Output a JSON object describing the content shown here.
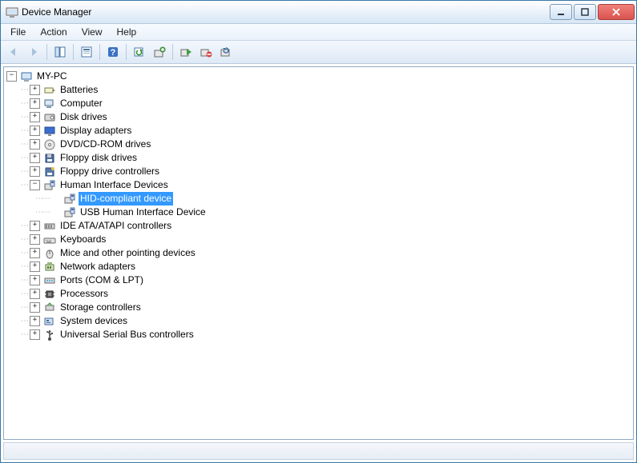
{
  "window": {
    "title": "Device Manager"
  },
  "menu": {
    "file": "File",
    "action": "Action",
    "view": "View",
    "help": "Help"
  },
  "toolbar": {
    "back": "Back",
    "forward": "Forward",
    "show_hide_tree": "Show/Hide Console Tree",
    "properties": "Properties",
    "help": "Help",
    "refresh": "Refresh",
    "update_driver": "Update Driver Software",
    "enable": "Enable",
    "disable": "Disable",
    "uninstall": "Uninstall"
  },
  "tree": {
    "root": "MY-PC",
    "nodes": [
      {
        "label": "Batteries",
        "icon": "battery",
        "expanded": false
      },
      {
        "label": "Computer",
        "icon": "computer",
        "expanded": false
      },
      {
        "label": "Disk drives",
        "icon": "disk",
        "expanded": false
      },
      {
        "label": "Display adapters",
        "icon": "display",
        "expanded": false
      },
      {
        "label": "DVD/CD-ROM drives",
        "icon": "cdrom",
        "expanded": false
      },
      {
        "label": "Floppy disk drives",
        "icon": "floppy",
        "expanded": false
      },
      {
        "label": "Floppy drive controllers",
        "icon": "floppy-ctrl",
        "expanded": false
      },
      {
        "label": "Human Interface Devices",
        "icon": "hid",
        "expanded": true,
        "children": [
          {
            "label": "HID-compliant device",
            "icon": "hid",
            "selected": true
          },
          {
            "label": "USB Human Interface Device",
            "icon": "hid",
            "selected": false
          }
        ]
      },
      {
        "label": "IDE ATA/ATAPI controllers",
        "icon": "ide",
        "expanded": false
      },
      {
        "label": "Keyboards",
        "icon": "keyboard",
        "expanded": false
      },
      {
        "label": "Mice and other pointing devices",
        "icon": "mouse",
        "expanded": false
      },
      {
        "label": "Network adapters",
        "icon": "network",
        "expanded": false
      },
      {
        "label": "Ports (COM & LPT)",
        "icon": "port",
        "expanded": false
      },
      {
        "label": "Processors",
        "icon": "cpu",
        "expanded": false
      },
      {
        "label": "Storage controllers",
        "icon": "storage",
        "expanded": false
      },
      {
        "label": "System devices",
        "icon": "system",
        "expanded": false
      },
      {
        "label": "Universal Serial Bus controllers",
        "icon": "usb",
        "expanded": false
      }
    ]
  }
}
